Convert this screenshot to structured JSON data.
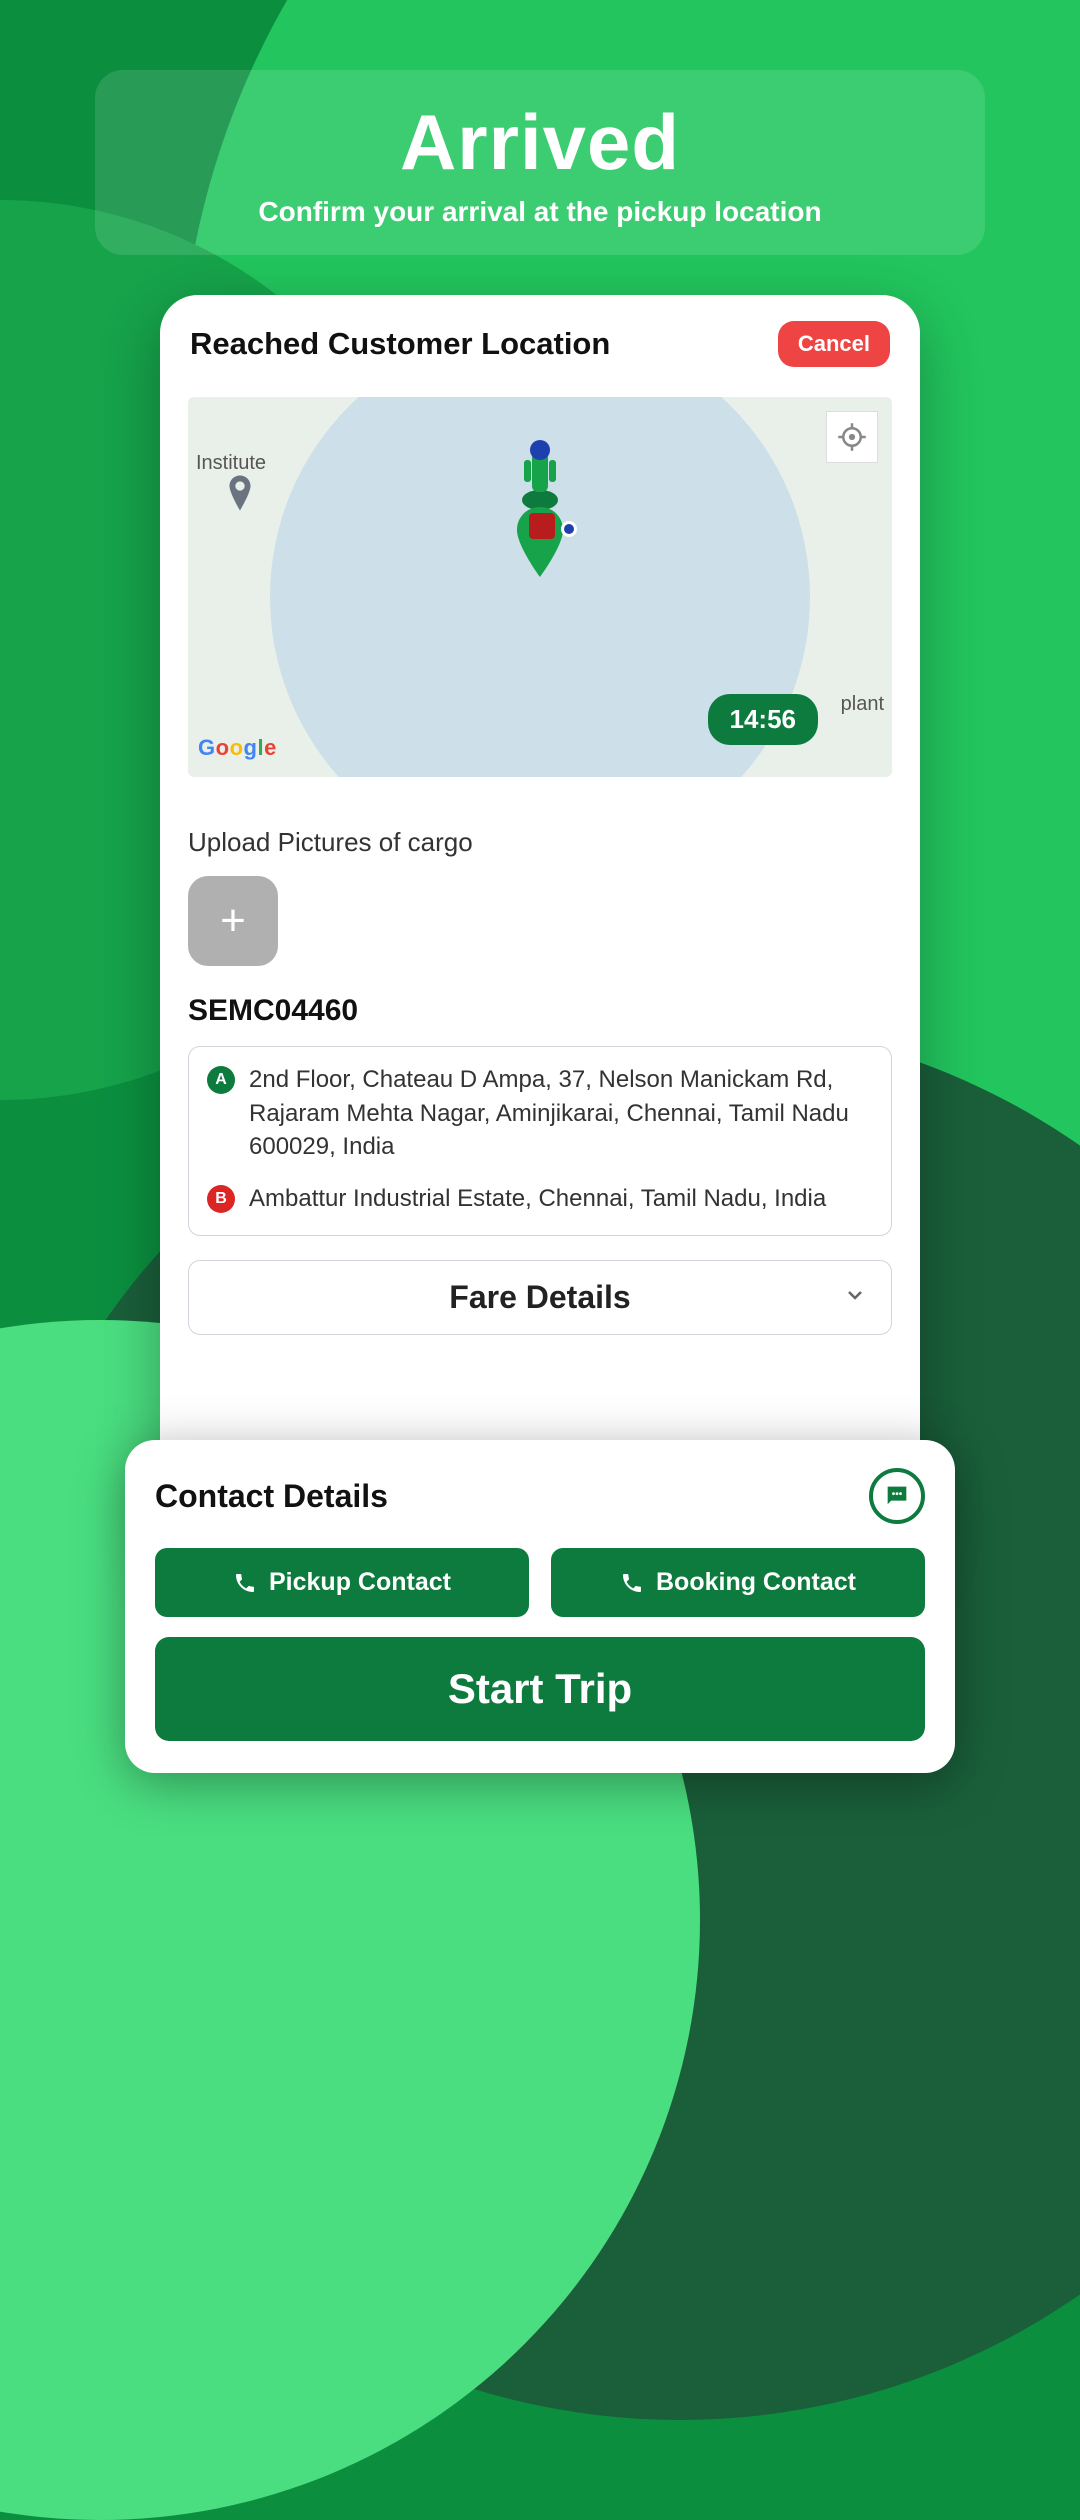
{
  "banner": {
    "title": "Arrived",
    "subtitle": "Confirm your arrival at the pickup location"
  },
  "card": {
    "title": "Reached Customer Location",
    "cancel_label": "Cancel"
  },
  "map": {
    "label_left": "Institute",
    "label_right": "plant",
    "timer": "14:56"
  },
  "upload": {
    "label": "Upload Pictures of cargo"
  },
  "order_id": "SEMC04460",
  "addresses": {
    "a": "2nd Floor, Chateau D Ampa, 37, Nelson Manickam Rd, Rajaram Mehta Nagar, Aminjikarai, Chennai, Tamil Nadu 600029, India",
    "b": "Ambattur Industrial Estate, Chennai, Tamil Nadu, India"
  },
  "fare": {
    "label": "Fare Details"
  },
  "contact": {
    "title": "Contact Details",
    "pickup_label": "Pickup Contact",
    "booking_label": "Booking Contact",
    "start_label": "Start Trip"
  }
}
